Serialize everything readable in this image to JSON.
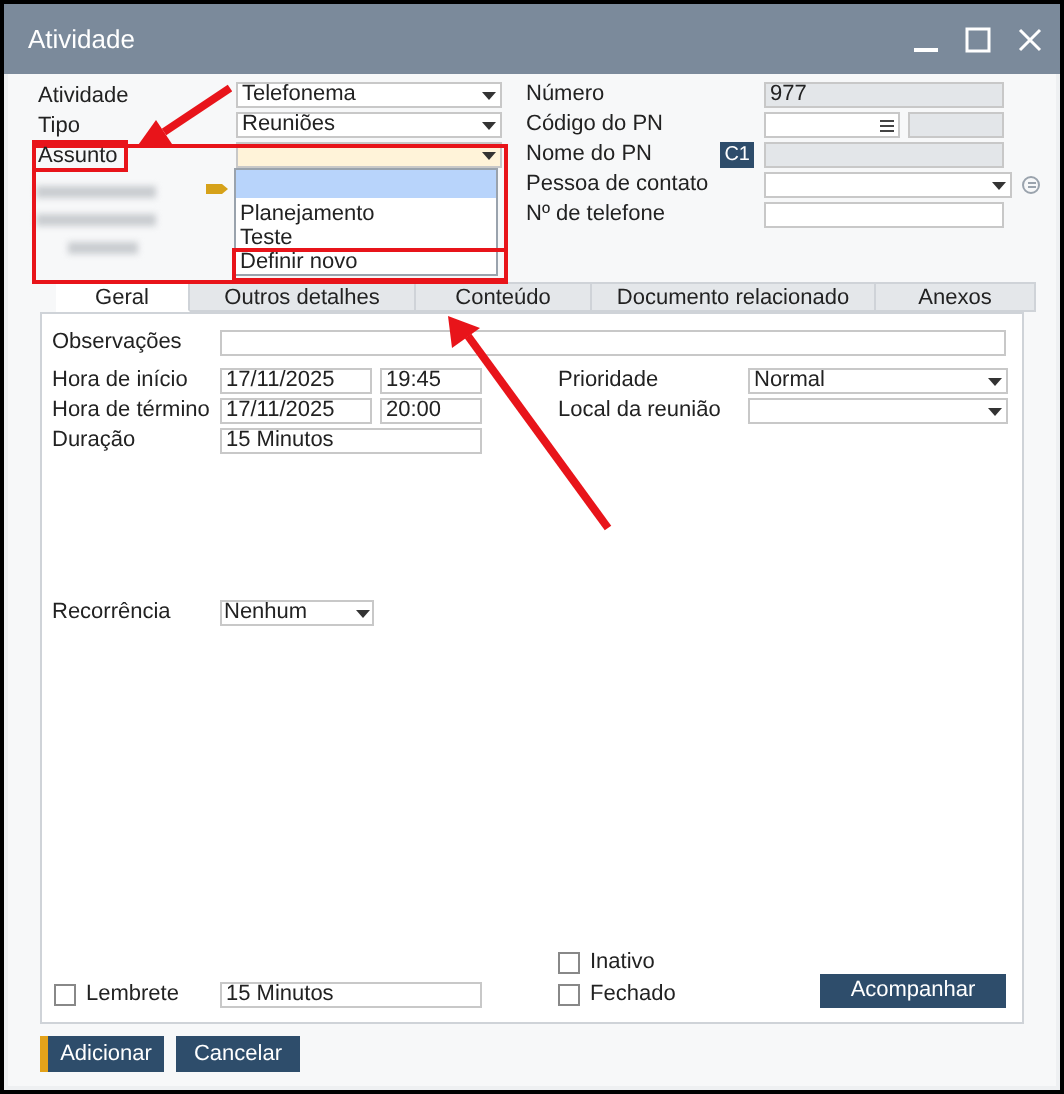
{
  "window": {
    "title": "Atividade"
  },
  "header_left": [
    {
      "label": "Atividade",
      "value": "Telefonema",
      "kind": "dropdown",
      "focused": false,
      "annotated": false
    },
    {
      "label": "Tipo",
      "value": "Reuniões",
      "kind": "dropdown",
      "focused": false,
      "annotated": false
    },
    {
      "label": "Assunto",
      "kind": "dropdown",
      "focused": true,
      "annotated": true
    }
  ],
  "assunto_dropdown": [
    {
      "selected": true
    },
    {
      "label": "Planejamento",
      "selected": false
    },
    {
      "label": "Teste",
      "selected": false
    },
    {
      "label": "Definir novo",
      "selected": false
    }
  ],
  "header_right": [
    {
      "label": "Número",
      "value": "977",
      "kind": "readonly"
    },
    {
      "label": "Código do PN",
      "kind": "lookup"
    },
    {
      "label": "Nome do PN",
      "kind": "badge",
      "badge": "C1"
    },
    {
      "label": "Pessoa de contato",
      "kind": "dropdown"
    },
    {
      "label": "Nº de telefone",
      "kind": "text"
    }
  ],
  "tabs": [
    {
      "label": "Geral",
      "selected": true
    },
    {
      "label": "Outros detalhes",
      "selected": false
    },
    {
      "label": "Conteúdo",
      "selected": false
    },
    {
      "label": "Documento relacionado",
      "selected": false
    },
    {
      "label": "Anexos",
      "selected": false
    }
  ],
  "general": {
    "observacoes": {
      "label": "Observações"
    },
    "hora_inicio": {
      "label": "Hora de início",
      "date": "17/11/2025",
      "time": "19:45"
    },
    "hora_termino": {
      "label": "Hora de término",
      "date": "17/11/2025",
      "time": "20:00"
    },
    "duracao": {
      "label": "Duração",
      "value": "15 Minutos"
    },
    "prioridade": {
      "label": "Prioridade",
      "value": "Normal"
    },
    "local": {
      "label": "Local da reunião"
    },
    "recorrencia": {
      "label": "Recorrência",
      "value": "Nenhum"
    },
    "lembrete": {
      "label": "Lembrete",
      "checked": false,
      "value": "15 Minutos"
    },
    "inativo": {
      "label": "Inativo",
      "checked": false
    },
    "fechado": {
      "label": "Fechado",
      "checked": false
    },
    "acompanhar": "Acompanhar"
  },
  "buttons": [
    {
      "label": "Adicionar",
      "default": true
    },
    {
      "label": "Cancelar",
      "default": false
    }
  ]
}
